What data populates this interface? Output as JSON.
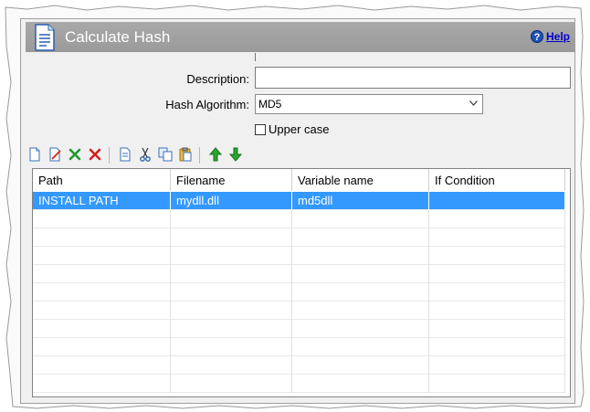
{
  "header": {
    "title": "Calculate Hash",
    "help_label": "Help",
    "help_icon": "help-icon",
    "doc_icon": "document-icon"
  },
  "form": {
    "description_label": "Description:",
    "description_value": "",
    "algorithm_label": "Hash Algorithm:",
    "algorithm_value": "MD5",
    "upper_case_label": "Upper case",
    "upper_case_checked": false
  },
  "toolbar": {
    "buttons": [
      "new-icon",
      "edit-icon",
      "delete-icon",
      "delete-all-icon",
      "copy-icon",
      "cut-icon",
      "duplicate-icon",
      "paste-icon",
      "move-up-icon",
      "move-down-icon"
    ]
  },
  "table": {
    "columns": [
      "Path",
      "Filename",
      "Variable name",
      "If Condition"
    ],
    "rows": [
      [
        "INSTALL PATH",
        "mydll.dll",
        "md5dll",
        ""
      ]
    ],
    "selected_row": 0,
    "empty_rows": 10
  },
  "colors": {
    "header_bg": "#9a9a9a",
    "selection": "#3399ff",
    "panel_bg": "#f0f0f0"
  }
}
